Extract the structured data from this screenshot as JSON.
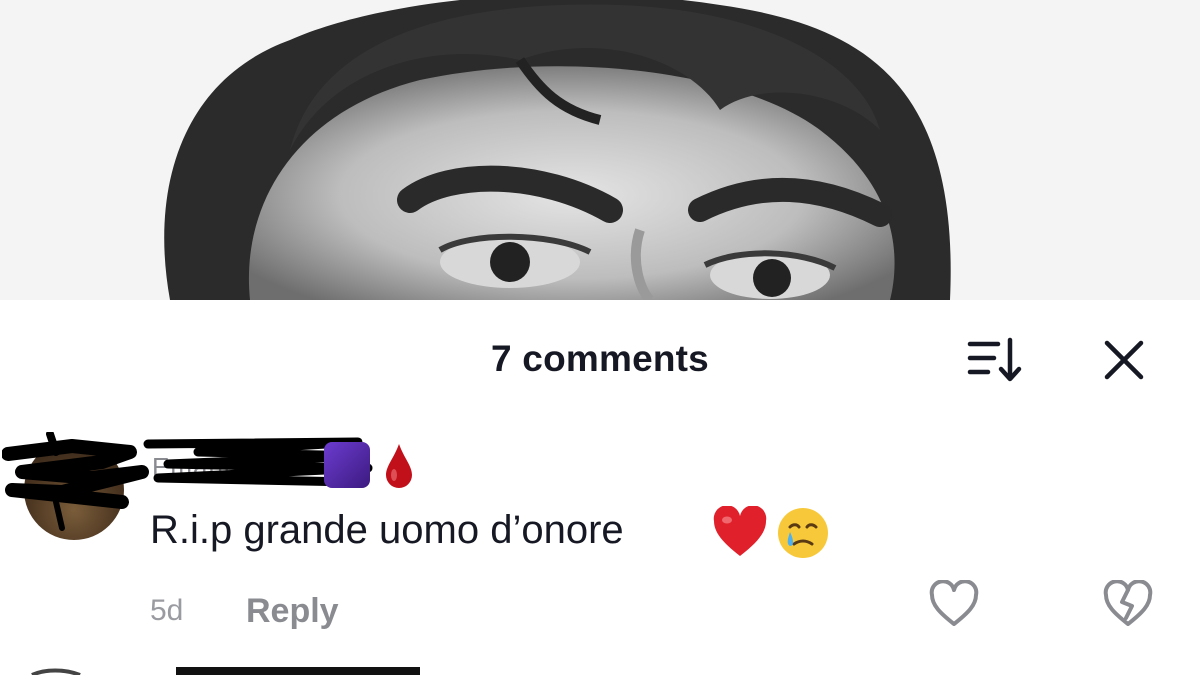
{
  "photo": {
    "alt_subject": "black-and-white portrait photo",
    "background_color": "#f3f3f3"
  },
  "header": {
    "title": "7 comments",
    "sort_icon": "sort-descending-icon",
    "close_icon": "close-icon"
  },
  "comment": {
    "username": "Emanuele",
    "badge_icon": "purple-badge-icon",
    "extra_icon": "blood-drop-icon",
    "text": "R.i.p grande uomo d’onore",
    "emojis": [
      "red-heart-icon",
      "face-holding-back-tears-icon"
    ],
    "timestamp": "5d",
    "reply_label": "Reply",
    "like_icon": "heart-outline-icon",
    "dislike_icon": "broken-heart-icon"
  },
  "colors": {
    "text_primary": "#161823",
    "text_secondary": "#8a8b91",
    "heart_red": "#e0202b"
  }
}
